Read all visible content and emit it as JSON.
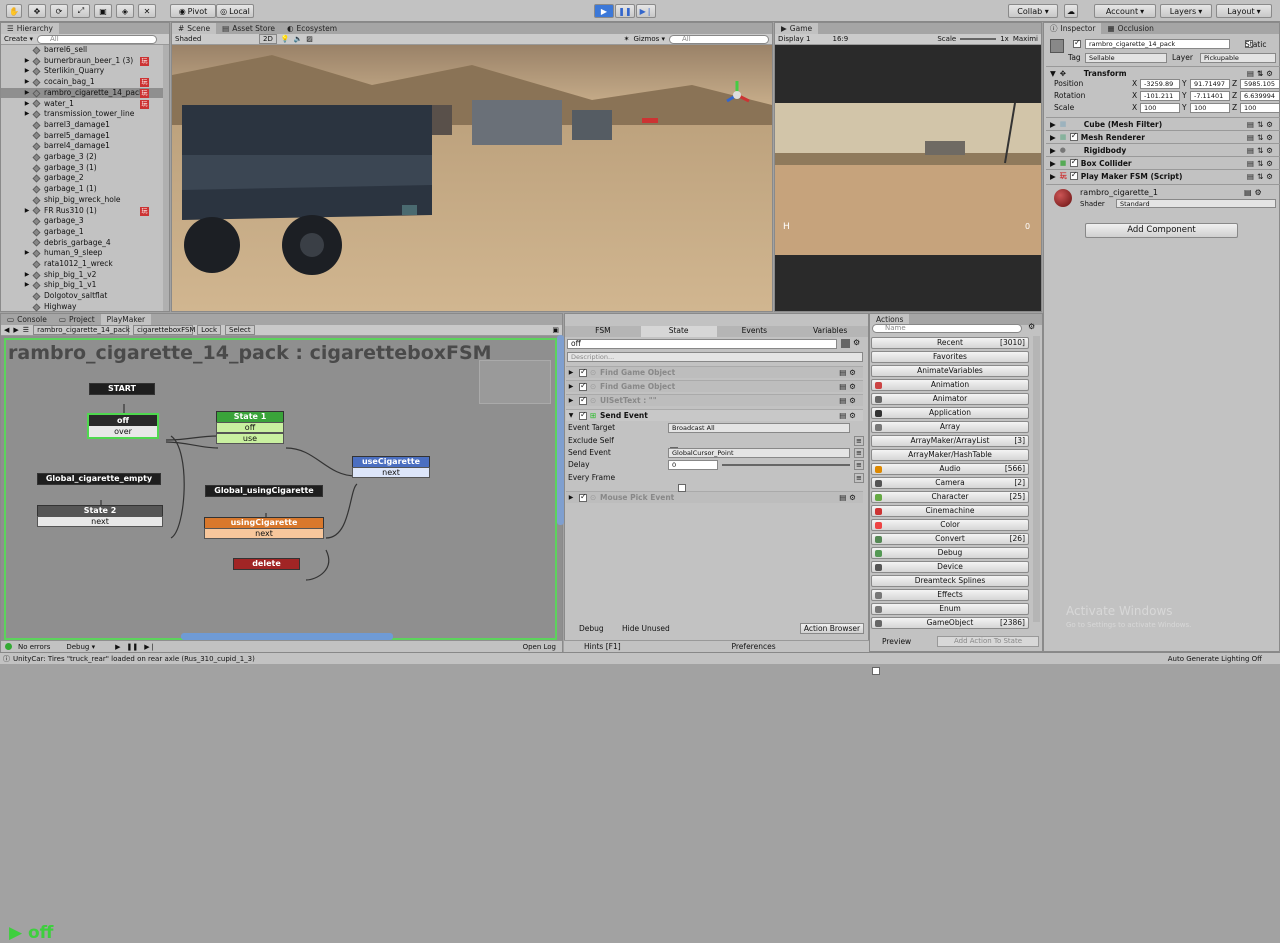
{
  "toolbar": {
    "pivot": "Pivot",
    "local": "Local",
    "collab": "Collab ▾",
    "account": "Account",
    "layers": "Layers",
    "layout": "Layout"
  },
  "hierarchy": {
    "tab": "Hierarchy",
    "create": "Create ▾",
    "search_placeholder": "All",
    "items": [
      {
        "label": "barrel6_sell",
        "arrow": false,
        "badge": false
      },
      {
        "label": "burnerbraun_beer_1 (3)",
        "arrow": true,
        "badge": true
      },
      {
        "label": "Sterlikin_Quarry",
        "arrow": true,
        "badge": false
      },
      {
        "label": "cocain_bag_1",
        "arrow": true,
        "badge": true
      },
      {
        "label": "rambro_cigarette_14_pack",
        "arrow": true,
        "badge": true,
        "selected": true
      },
      {
        "label": "water_1",
        "arrow": true,
        "badge": true
      },
      {
        "label": "transmission_tower_line",
        "arrow": true,
        "badge": false
      },
      {
        "label": "barrel3_damage1",
        "arrow": false,
        "badge": false
      },
      {
        "label": "barrel5_damage1",
        "arrow": false,
        "badge": false
      },
      {
        "label": "barrel4_damage1",
        "arrow": false,
        "badge": false
      },
      {
        "label": "garbage_3 (2)",
        "arrow": false,
        "badge": false
      },
      {
        "label": "garbage_3 (1)",
        "arrow": false,
        "badge": false
      },
      {
        "label": "garbage_2",
        "arrow": false,
        "badge": false
      },
      {
        "label": "garbage_1 (1)",
        "arrow": false,
        "badge": false
      },
      {
        "label": "ship_big_wreck_hole",
        "arrow": false,
        "badge": false
      },
      {
        "label": "FR Rus310 (1)",
        "arrow": true,
        "badge": true
      },
      {
        "label": "garbage_3",
        "arrow": false,
        "badge": false
      },
      {
        "label": "garbage_1",
        "arrow": false,
        "badge": false
      },
      {
        "label": "debris_garbage_4",
        "arrow": false,
        "badge": false
      },
      {
        "label": "human_9_sleep",
        "arrow": true,
        "badge": false
      },
      {
        "label": "rata1012_1_wreck",
        "arrow": false,
        "badge": false
      },
      {
        "label": "ship_big_1_v2",
        "arrow": true,
        "badge": false
      },
      {
        "label": "ship_big_1_v1",
        "arrow": true,
        "badge": false
      },
      {
        "label": "Dolgotov_saltflat",
        "arrow": false,
        "badge": false
      },
      {
        "label": "Highway",
        "arrow": false,
        "badge": false
      }
    ]
  },
  "scene": {
    "tabs": [
      "Scene",
      "Asset Store",
      "Ecosystem"
    ],
    "shaded": "Shaded",
    "mode2d": "2D",
    "gizmos": "Gizmos ▾",
    "search_placeholder": "All"
  },
  "game": {
    "tab": "Game",
    "display": "Display 1",
    "aspect": "16:9",
    "scale_label": "Scale",
    "scale_value": "1x",
    "maximize": "Maximi",
    "hud_h": "H",
    "hud_num": "0"
  },
  "playmaker": {
    "tabs": [
      "Console",
      "Project",
      "PlayMaker"
    ],
    "object": "rambro_cigarette_14_pack",
    "fsm": "cigaretteboxFSM",
    "lock": "Lock",
    "select": "Select",
    "title": "rambro_cigarette_14_pack : cigaretteboxFSM",
    "state_display": "off",
    "nodes": {
      "start": "START",
      "off": "off",
      "off_event": "over",
      "state1": "State 1",
      "state1_e1": "off",
      "state1_e2": "use",
      "usecig": "useCigarette",
      "usecig_e": "next",
      "global_empty": "Global_cigarette_empty",
      "state2": "State 2",
      "state2_e": "next",
      "global_using": "Global_usingCigarette",
      "using": "usingCigarette",
      "using_e": "next",
      "delete": "delete"
    },
    "bottom": {
      "errors": "No errors",
      "debug": "Debug ▾",
      "openlog": "Open Log"
    }
  },
  "state_panel": {
    "tabs": [
      "FSM",
      "State",
      "Events",
      "Variables"
    ],
    "name": "off",
    "description_placeholder": "Description...",
    "actions": [
      "Find Game Object",
      "Find Game Object",
      "UISetText : \"\"",
      "Send Event",
      "Mouse Pick Event"
    ],
    "fields": [
      {
        "label": "Event Target",
        "value": "Broadcast All"
      },
      {
        "label": "Exclude Self",
        "value": ""
      },
      {
        "label": "Send Event",
        "value": "GlobalCursor_Point"
      },
      {
        "label": "Delay",
        "value": "0"
      },
      {
        "label": "Every Frame",
        "value": ""
      }
    ],
    "debug": "Debug",
    "hide_unused": "Hide Unused",
    "action_browser": "Action Browser",
    "hints": "Hints [F1]",
    "preferences": "Preferences"
  },
  "actions_panel": {
    "tab": "Actions",
    "search_placeholder": "Name",
    "items": [
      {
        "label": "Recent",
        "count": "[3010]",
        "color": ""
      },
      {
        "label": "Favorites",
        "count": "",
        "color": ""
      },
      {
        "label": "AnimateVariables",
        "count": "",
        "color": ""
      },
      {
        "label": "Animation",
        "count": "",
        "color": "#c44"
      },
      {
        "label": "Animator",
        "count": "",
        "color": "#666"
      },
      {
        "label": "Application",
        "count": "",
        "color": "#333"
      },
      {
        "label": "Array",
        "count": "",
        "color": "#777"
      },
      {
        "label": "ArrayMaker/ArrayList",
        "count": "[3]",
        "color": ""
      },
      {
        "label": "ArrayMaker/HashTable",
        "count": "",
        "color": ""
      },
      {
        "label": "Audio",
        "count": "[566]",
        "color": "#d80"
      },
      {
        "label": "Camera",
        "count": "[2]",
        "color": "#555"
      },
      {
        "label": "Character",
        "count": "[25]",
        "color": "#6a4"
      },
      {
        "label": "Cinemachine",
        "count": "",
        "color": "#c33"
      },
      {
        "label": "Color",
        "count": "",
        "color": "#e44"
      },
      {
        "label": "Convert",
        "count": "[26]",
        "color": "#585"
      },
      {
        "label": "Debug",
        "count": "",
        "color": "#595"
      },
      {
        "label": "Device",
        "count": "",
        "color": "#555"
      },
      {
        "label": "Dreamteck Splines",
        "count": "",
        "color": ""
      },
      {
        "label": "Effects",
        "count": "",
        "color": "#777"
      },
      {
        "label": "Enum",
        "count": "",
        "color": "#777"
      },
      {
        "label": "GameObject",
        "count": "[2386]",
        "color": "#666"
      }
    ],
    "preview": "Preview",
    "add_action": "Add Action To State"
  },
  "inspector": {
    "tabs": [
      "Inspector",
      "Occlusion"
    ],
    "name": "rambro_cigarette_14_pack",
    "static": "Static",
    "tag_label": "Tag",
    "tag": "Sellable",
    "layer_label": "Layer",
    "layer": "Pickupable",
    "transform": "Transform",
    "position_label": "Position",
    "rotation_label": "Rotation",
    "scale_label": "Scale",
    "position": [
      "-3259.89",
      "91.71497",
      "5985.105"
    ],
    "rotation": [
      "-101.211",
      "-7.11401",
      "6.639994"
    ],
    "scale": [
      "100",
      "100",
      "100"
    ],
    "components": [
      "Cube (Mesh Filter)",
      "Mesh Renderer",
      "Rigidbody",
      "Box Collider",
      "Play Maker FSM (Script)"
    ],
    "material": "rambro_cigarette_1",
    "shader_label": "Shader",
    "shader": "Standard",
    "add_component": "Add Component"
  },
  "status": {
    "message": "UnityCar: Tires \"truck_rear\" loaded on rear axle (Rus_310_cupid_1_3)",
    "right": "Auto Generate Lighting Off"
  },
  "watermark": {
    "line1": "Activate Windows",
    "line2": "Go to Settings to activate Windows."
  }
}
